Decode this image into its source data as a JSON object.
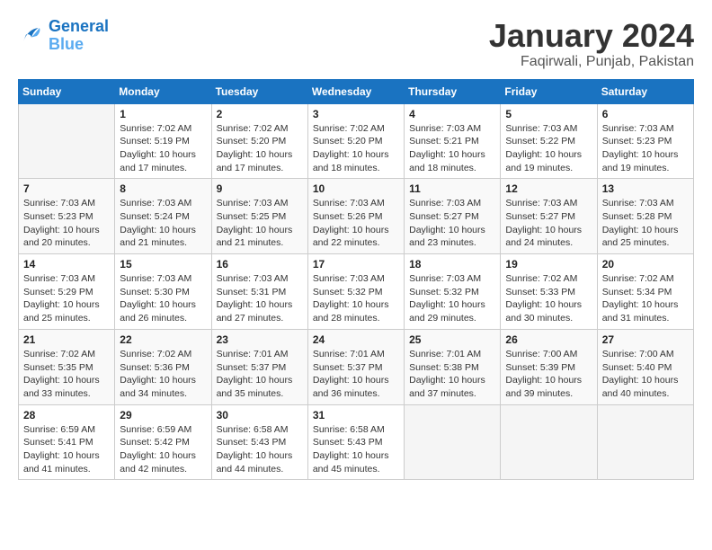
{
  "header": {
    "logo_line1": "General",
    "logo_line2": "Blue",
    "month_title": "January 2024",
    "subtitle": "Faqirwali, Punjab, Pakistan"
  },
  "days_of_week": [
    "Sunday",
    "Monday",
    "Tuesday",
    "Wednesday",
    "Thursday",
    "Friday",
    "Saturday"
  ],
  "weeks": [
    [
      {
        "day": "",
        "info": ""
      },
      {
        "day": "1",
        "info": "Sunrise: 7:02 AM\nSunset: 5:19 PM\nDaylight: 10 hours\nand 17 minutes."
      },
      {
        "day": "2",
        "info": "Sunrise: 7:02 AM\nSunset: 5:20 PM\nDaylight: 10 hours\nand 17 minutes."
      },
      {
        "day": "3",
        "info": "Sunrise: 7:02 AM\nSunset: 5:20 PM\nDaylight: 10 hours\nand 18 minutes."
      },
      {
        "day": "4",
        "info": "Sunrise: 7:03 AM\nSunset: 5:21 PM\nDaylight: 10 hours\nand 18 minutes."
      },
      {
        "day": "5",
        "info": "Sunrise: 7:03 AM\nSunset: 5:22 PM\nDaylight: 10 hours\nand 19 minutes."
      },
      {
        "day": "6",
        "info": "Sunrise: 7:03 AM\nSunset: 5:23 PM\nDaylight: 10 hours\nand 19 minutes."
      }
    ],
    [
      {
        "day": "7",
        "info": "Sunrise: 7:03 AM\nSunset: 5:23 PM\nDaylight: 10 hours\nand 20 minutes."
      },
      {
        "day": "8",
        "info": "Sunrise: 7:03 AM\nSunset: 5:24 PM\nDaylight: 10 hours\nand 21 minutes."
      },
      {
        "day": "9",
        "info": "Sunrise: 7:03 AM\nSunset: 5:25 PM\nDaylight: 10 hours\nand 21 minutes."
      },
      {
        "day": "10",
        "info": "Sunrise: 7:03 AM\nSunset: 5:26 PM\nDaylight: 10 hours\nand 22 minutes."
      },
      {
        "day": "11",
        "info": "Sunrise: 7:03 AM\nSunset: 5:27 PM\nDaylight: 10 hours\nand 23 minutes."
      },
      {
        "day": "12",
        "info": "Sunrise: 7:03 AM\nSunset: 5:27 PM\nDaylight: 10 hours\nand 24 minutes."
      },
      {
        "day": "13",
        "info": "Sunrise: 7:03 AM\nSunset: 5:28 PM\nDaylight: 10 hours\nand 25 minutes."
      }
    ],
    [
      {
        "day": "14",
        "info": "Sunrise: 7:03 AM\nSunset: 5:29 PM\nDaylight: 10 hours\nand 25 minutes."
      },
      {
        "day": "15",
        "info": "Sunrise: 7:03 AM\nSunset: 5:30 PM\nDaylight: 10 hours\nand 26 minutes."
      },
      {
        "day": "16",
        "info": "Sunrise: 7:03 AM\nSunset: 5:31 PM\nDaylight: 10 hours\nand 27 minutes."
      },
      {
        "day": "17",
        "info": "Sunrise: 7:03 AM\nSunset: 5:32 PM\nDaylight: 10 hours\nand 28 minutes."
      },
      {
        "day": "18",
        "info": "Sunrise: 7:03 AM\nSunset: 5:32 PM\nDaylight: 10 hours\nand 29 minutes."
      },
      {
        "day": "19",
        "info": "Sunrise: 7:02 AM\nSunset: 5:33 PM\nDaylight: 10 hours\nand 30 minutes."
      },
      {
        "day": "20",
        "info": "Sunrise: 7:02 AM\nSunset: 5:34 PM\nDaylight: 10 hours\nand 31 minutes."
      }
    ],
    [
      {
        "day": "21",
        "info": "Sunrise: 7:02 AM\nSunset: 5:35 PM\nDaylight: 10 hours\nand 33 minutes."
      },
      {
        "day": "22",
        "info": "Sunrise: 7:02 AM\nSunset: 5:36 PM\nDaylight: 10 hours\nand 34 minutes."
      },
      {
        "day": "23",
        "info": "Sunrise: 7:01 AM\nSunset: 5:37 PM\nDaylight: 10 hours\nand 35 minutes."
      },
      {
        "day": "24",
        "info": "Sunrise: 7:01 AM\nSunset: 5:37 PM\nDaylight: 10 hours\nand 36 minutes."
      },
      {
        "day": "25",
        "info": "Sunrise: 7:01 AM\nSunset: 5:38 PM\nDaylight: 10 hours\nand 37 minutes."
      },
      {
        "day": "26",
        "info": "Sunrise: 7:00 AM\nSunset: 5:39 PM\nDaylight: 10 hours\nand 39 minutes."
      },
      {
        "day": "27",
        "info": "Sunrise: 7:00 AM\nSunset: 5:40 PM\nDaylight: 10 hours\nand 40 minutes."
      }
    ],
    [
      {
        "day": "28",
        "info": "Sunrise: 6:59 AM\nSunset: 5:41 PM\nDaylight: 10 hours\nand 41 minutes."
      },
      {
        "day": "29",
        "info": "Sunrise: 6:59 AM\nSunset: 5:42 PM\nDaylight: 10 hours\nand 42 minutes."
      },
      {
        "day": "30",
        "info": "Sunrise: 6:58 AM\nSunset: 5:43 PM\nDaylight: 10 hours\nand 44 minutes."
      },
      {
        "day": "31",
        "info": "Sunrise: 6:58 AM\nSunset: 5:43 PM\nDaylight: 10 hours\nand 45 minutes."
      },
      {
        "day": "",
        "info": ""
      },
      {
        "day": "",
        "info": ""
      },
      {
        "day": "",
        "info": ""
      }
    ]
  ]
}
